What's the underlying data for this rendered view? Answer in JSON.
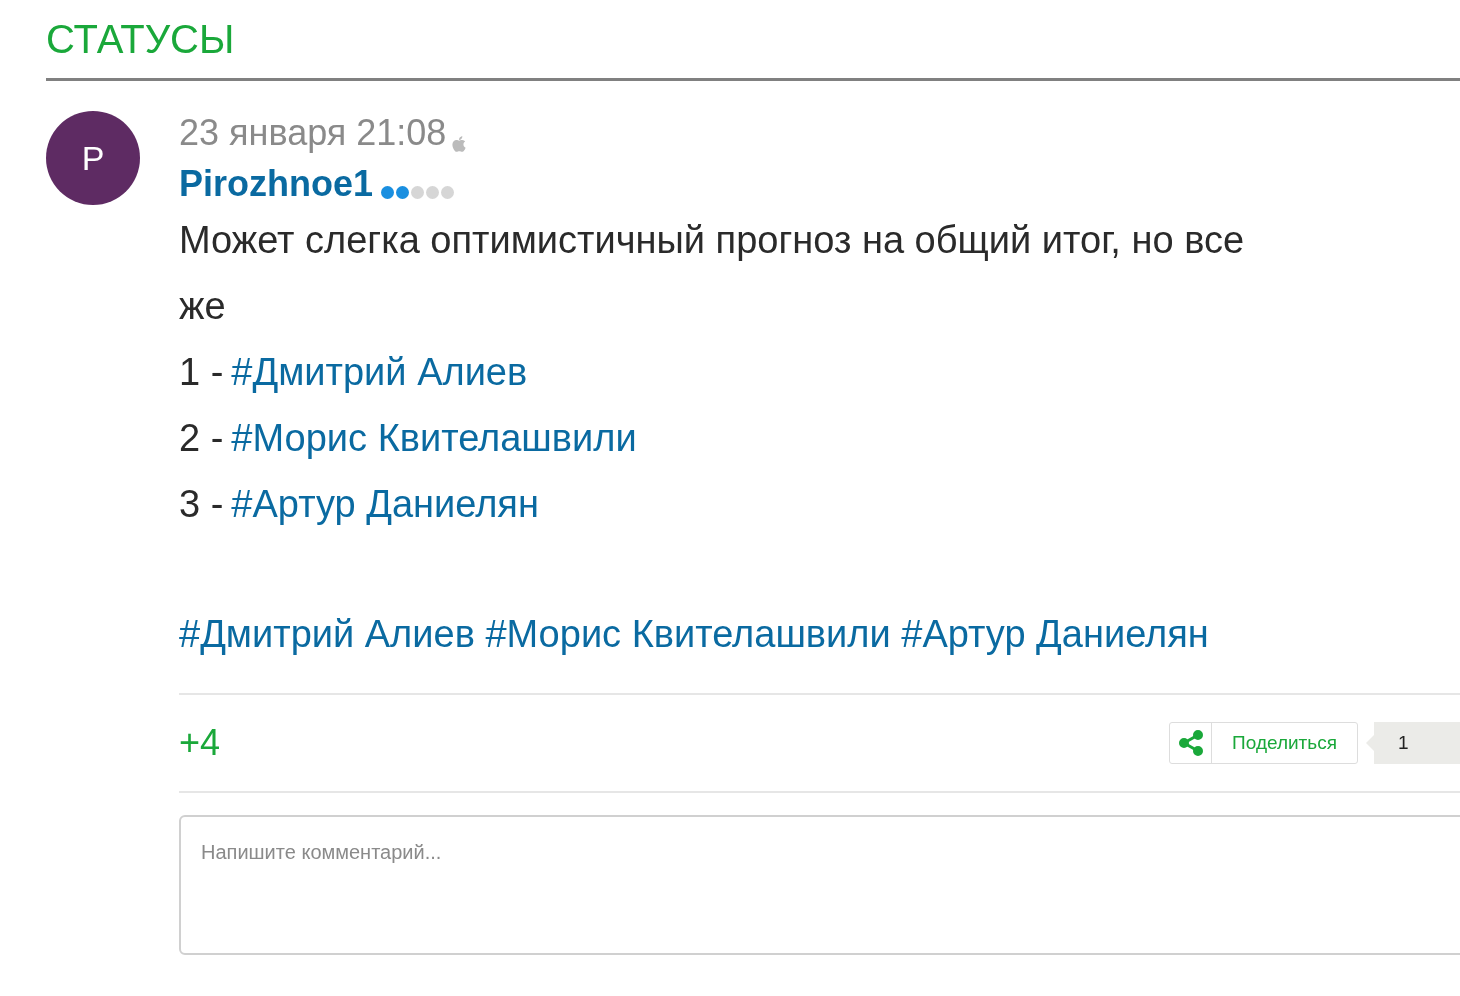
{
  "section_title": "СТАТУСЫ",
  "post": {
    "avatar_letter": "P",
    "time": "23 января 21:08",
    "author": "Pirozhnoe1",
    "rank": {
      "stars": 2
    },
    "text": "Может слегка оптимистичный прогноз на общий итог, но все же",
    "list": [
      {
        "number": "1 -",
        "link": "#Дмитрий Алиев"
      },
      {
        "number": "2 -",
        "link": "#Морис Квителашвили"
      },
      {
        "number": "3 -",
        "link": "#Артур Даниелян"
      }
    ],
    "tags": [
      "#Дмитрий Алиев",
      "#Морис Квителашвили",
      "#Артур Даниелян"
    ],
    "rating": "+4",
    "share_label": "Поделиться",
    "share_count": "1"
  },
  "comment": {
    "placeholder": "Напишите комментарий..."
  }
}
